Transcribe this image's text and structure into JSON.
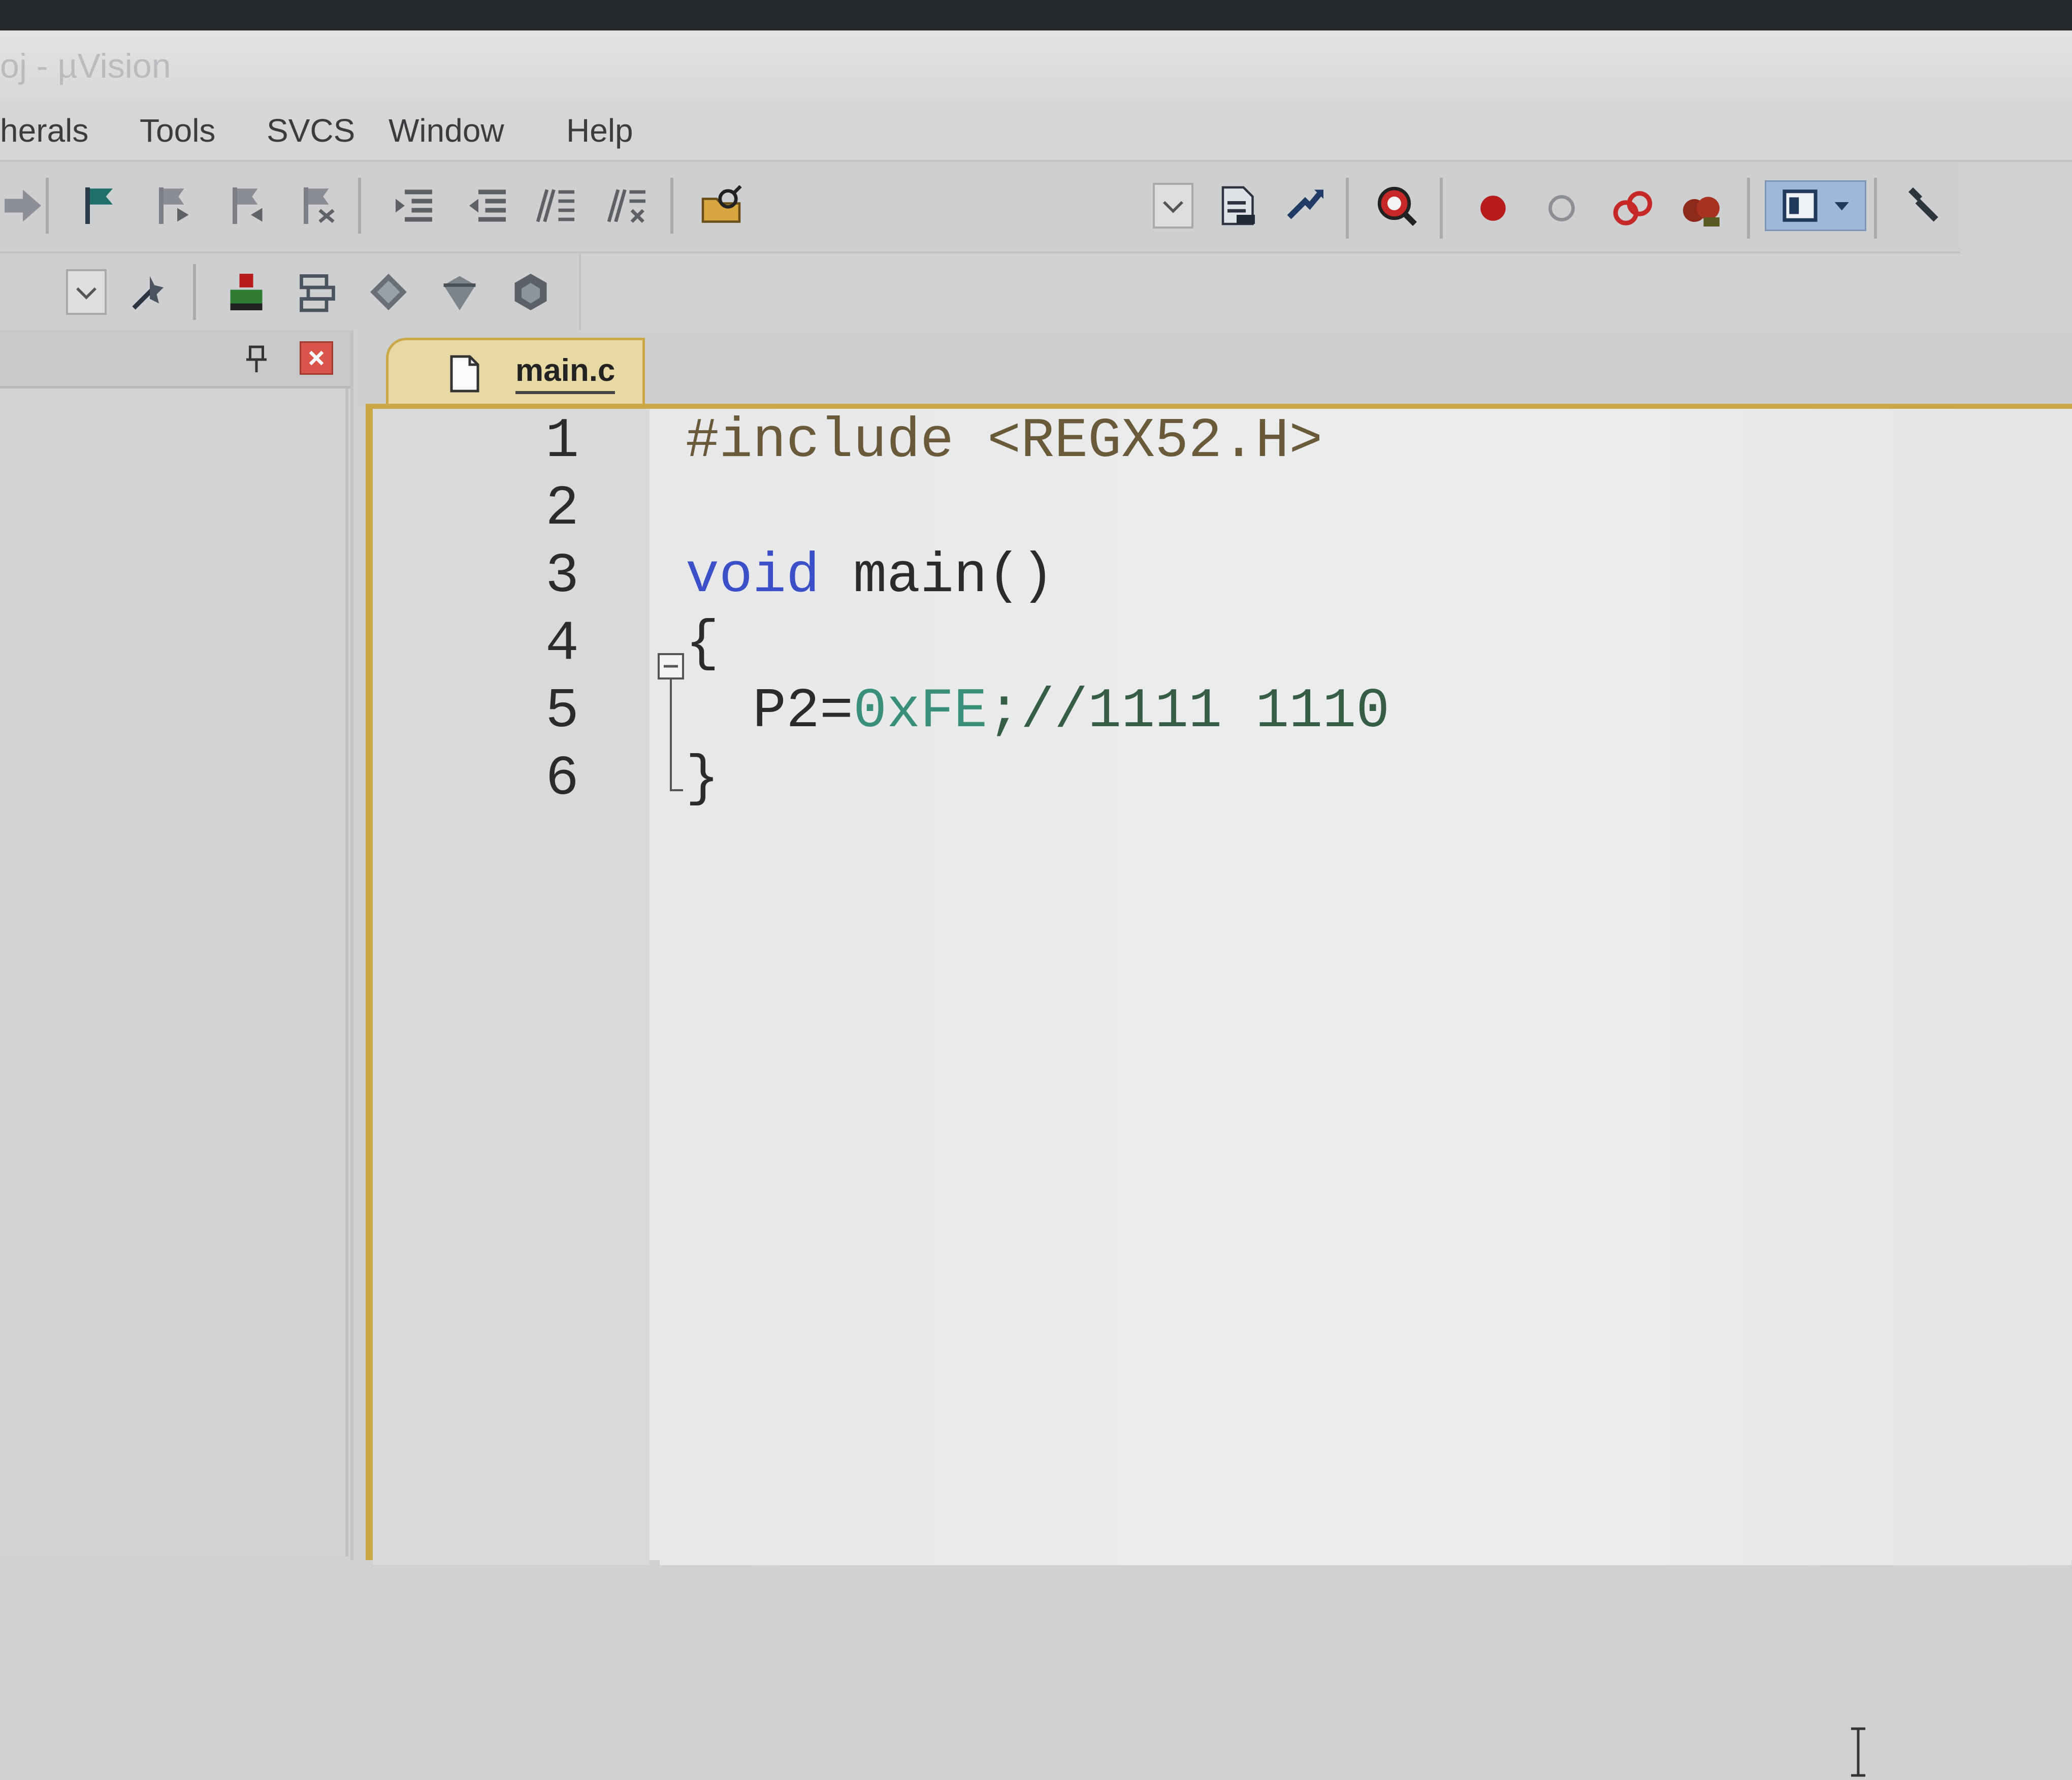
{
  "window": {
    "title": "oj - µVision"
  },
  "menu": [
    "herals",
    "Tools",
    "SVCS",
    "Window",
    "Help"
  ],
  "editor": {
    "tab_label": "main.c",
    "lines": [
      {
        "num": "1",
        "segments": [
          {
            "text": "#include <REGX52.H>",
            "cls": "pp"
          }
        ]
      },
      {
        "num": "2",
        "segments": []
      },
      {
        "num": "3",
        "segments": [
          {
            "text": "void",
            "cls": "kw"
          },
          {
            "text": " main()",
            "cls": ""
          }
        ]
      },
      {
        "num": "4",
        "segments": [
          {
            "text": "{",
            "cls": ""
          }
        ]
      },
      {
        "num": "5",
        "segments": [
          {
            "text": "  P2=",
            "cls": ""
          },
          {
            "text": "0xFE",
            "cls": "num"
          },
          {
            "text": ";//1111 1110",
            "cls": "cm"
          }
        ]
      },
      {
        "num": "6",
        "segments": [
          {
            "text": "}",
            "cls": ""
          }
        ]
      }
    ]
  },
  "toolbar_icons": {
    "row1": [
      "arrow-icon",
      "flag-bookmark-icon",
      "prev-bookmark-icon",
      "next-bookmark-icon",
      "clear-bookmarks-icon",
      "indent-icon",
      "unindent-icon",
      "comment-icon",
      "uncomment-icon",
      "find-in-files-icon",
      "combo-dropdown",
      "file-icon",
      "cross-ref-icon",
      "debug-start-icon",
      "breakpoint-icon",
      "breakpoint-disabled-icon",
      "kill-breakpoints-icon",
      "disable-all-breakpoints-icon",
      "window-layout-icon",
      "configure-icon"
    ],
    "row2": [
      "target-select-dropdown",
      "manage-project-icon",
      "project-items-icon",
      "select-packs-icon",
      "pack-installer-icon",
      "rte-icon",
      "vcs-icon"
    ]
  },
  "colors": {
    "keyword": "#3b4fc8",
    "number": "#3a8f7a",
    "preprocessor": "#6b5a3a",
    "tab_accent": "#c9a845"
  }
}
